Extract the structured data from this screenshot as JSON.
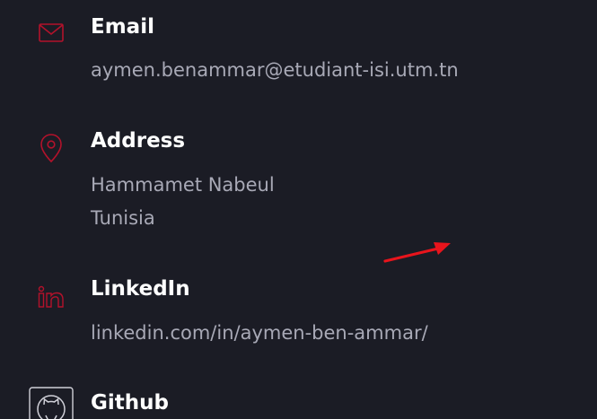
{
  "colors": {
    "background": "#1b1c25",
    "accent": "#b3122b",
    "title": "#ffffff",
    "value": "#a8a9b6",
    "annotation_arrow": "#e8141c"
  },
  "contacts": {
    "email": {
      "icon": "envelope-icon",
      "title": "Email",
      "value": "aymen.benammar@etudiant-isi.utm.tn"
    },
    "address": {
      "icon": "map-pin-icon",
      "title": "Address",
      "line1": "Hammamet Nabeul",
      "line2": "Tunisia"
    },
    "linkedin": {
      "icon": "linkedin-icon",
      "title": "LinkedIn",
      "value": "linkedin.com/in/aymen-ben-ammar/"
    },
    "github": {
      "icon": "github-icon",
      "title": "Github"
    }
  },
  "annotation": {
    "icon": "red-arrow-icon"
  }
}
